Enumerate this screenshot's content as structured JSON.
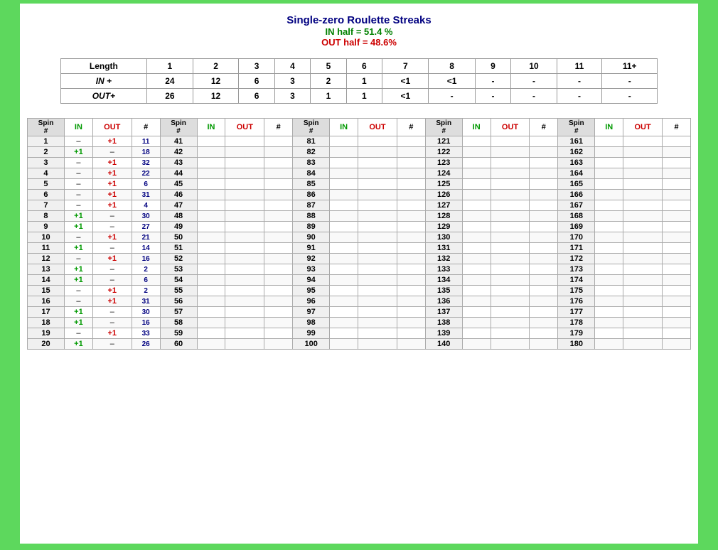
{
  "header": {
    "title": "Single-zero Roulette Streaks",
    "in_stat": "IN half = 51.4 %",
    "out_stat": "OUT half = 48.6%"
  },
  "summary": {
    "columns": [
      "Length",
      "1",
      "2",
      "3",
      "4",
      "5",
      "6",
      "7",
      "8",
      "9",
      "10",
      "11",
      "11+"
    ],
    "rows": [
      {
        "label": "IN +",
        "values": [
          "24",
          "12",
          "6",
          "3",
          "2",
          "1",
          "<1",
          "<1",
          "-",
          "-",
          "-",
          "-"
        ]
      },
      {
        "label": "OUT+",
        "values": [
          "26",
          "12",
          "6",
          "3",
          "1",
          "1",
          "<1",
          "-",
          "-",
          "-",
          "-",
          "-"
        ]
      }
    ]
  },
  "spin_columns": [
    {
      "spins": [
        {
          "num": 1,
          "in": "–",
          "out": "+1",
          "hash": "11"
        },
        {
          "num": 2,
          "in": "+1",
          "out": "–",
          "hash": "18"
        },
        {
          "num": 3,
          "in": "–",
          "out": "+1",
          "hash": "32"
        },
        {
          "num": 4,
          "in": "–",
          "out": "+1",
          "hash": "22"
        },
        {
          "num": 5,
          "in": "–",
          "out": "+1",
          "hash": "6"
        },
        {
          "num": 6,
          "in": "–",
          "out": "+1",
          "hash": "31"
        },
        {
          "num": 7,
          "in": "–",
          "out": "+1",
          "hash": "4"
        },
        {
          "num": 8,
          "in": "+1",
          "out": "–",
          "hash": "30"
        },
        {
          "num": 9,
          "in": "+1",
          "out": "–",
          "hash": "27"
        },
        {
          "num": 10,
          "in": "–",
          "out": "+1",
          "hash": "21"
        },
        {
          "num": 11,
          "in": "+1",
          "out": "–",
          "hash": "14"
        },
        {
          "num": 12,
          "in": "–",
          "out": "+1",
          "hash": "16"
        },
        {
          "num": 13,
          "in": "+1",
          "out": "–",
          "hash": "2"
        },
        {
          "num": 14,
          "in": "+1",
          "out": "–",
          "hash": "6"
        },
        {
          "num": 15,
          "in": "–",
          "out": "+1",
          "hash": "2"
        },
        {
          "num": 16,
          "in": "–",
          "out": "+1",
          "hash": "31"
        },
        {
          "num": 17,
          "in": "+1",
          "out": "–",
          "hash": "30"
        },
        {
          "num": 18,
          "in": "+1",
          "out": "–",
          "hash": "16"
        },
        {
          "num": 19,
          "in": "–",
          "out": "+1",
          "hash": "33"
        },
        {
          "num": 20,
          "in": "+1",
          "out": "–",
          "hash": "26"
        }
      ]
    },
    {
      "spins": [
        {
          "num": 41,
          "in": "",
          "out": "",
          "hash": ""
        },
        {
          "num": 42,
          "in": "",
          "out": "",
          "hash": ""
        },
        {
          "num": 43,
          "in": "",
          "out": "",
          "hash": ""
        },
        {
          "num": 44,
          "in": "",
          "out": "",
          "hash": ""
        },
        {
          "num": 45,
          "in": "",
          "out": "",
          "hash": ""
        },
        {
          "num": 46,
          "in": "",
          "out": "",
          "hash": ""
        },
        {
          "num": 47,
          "in": "",
          "out": "",
          "hash": ""
        },
        {
          "num": 48,
          "in": "",
          "out": "",
          "hash": ""
        },
        {
          "num": 49,
          "in": "",
          "out": "",
          "hash": ""
        },
        {
          "num": 50,
          "in": "",
          "out": "",
          "hash": ""
        },
        {
          "num": 51,
          "in": "",
          "out": "",
          "hash": ""
        },
        {
          "num": 52,
          "in": "",
          "out": "",
          "hash": ""
        },
        {
          "num": 53,
          "in": "",
          "out": "",
          "hash": ""
        },
        {
          "num": 54,
          "in": "",
          "out": "",
          "hash": ""
        },
        {
          "num": 55,
          "in": "",
          "out": "",
          "hash": ""
        },
        {
          "num": 56,
          "in": "",
          "out": "",
          "hash": ""
        },
        {
          "num": 57,
          "in": "",
          "out": "",
          "hash": ""
        },
        {
          "num": 58,
          "in": "",
          "out": "",
          "hash": ""
        },
        {
          "num": 59,
          "in": "",
          "out": "",
          "hash": ""
        },
        {
          "num": 60,
          "in": "",
          "out": "",
          "hash": ""
        }
      ]
    },
    {
      "spins": [
        {
          "num": 81,
          "in": "",
          "out": "",
          "hash": ""
        },
        {
          "num": 82,
          "in": "",
          "out": "",
          "hash": ""
        },
        {
          "num": 83,
          "in": "",
          "out": "",
          "hash": ""
        },
        {
          "num": 84,
          "in": "",
          "out": "",
          "hash": ""
        },
        {
          "num": 85,
          "in": "",
          "out": "",
          "hash": ""
        },
        {
          "num": 86,
          "in": "",
          "out": "",
          "hash": ""
        },
        {
          "num": 87,
          "in": "",
          "out": "",
          "hash": ""
        },
        {
          "num": 88,
          "in": "",
          "out": "",
          "hash": ""
        },
        {
          "num": 89,
          "in": "",
          "out": "",
          "hash": ""
        },
        {
          "num": 90,
          "in": "",
          "out": "",
          "hash": ""
        },
        {
          "num": 91,
          "in": "",
          "out": "",
          "hash": ""
        },
        {
          "num": 92,
          "in": "",
          "out": "",
          "hash": ""
        },
        {
          "num": 93,
          "in": "",
          "out": "",
          "hash": ""
        },
        {
          "num": 94,
          "in": "",
          "out": "",
          "hash": ""
        },
        {
          "num": 95,
          "in": "",
          "out": "",
          "hash": ""
        },
        {
          "num": 96,
          "in": "",
          "out": "",
          "hash": ""
        },
        {
          "num": 97,
          "in": "",
          "out": "",
          "hash": ""
        },
        {
          "num": 98,
          "in": "",
          "out": "",
          "hash": ""
        },
        {
          "num": 99,
          "in": "",
          "out": "",
          "hash": ""
        },
        {
          "num": 100,
          "in": "",
          "out": "",
          "hash": ""
        }
      ]
    },
    {
      "spins": [
        {
          "num": 121,
          "in": "",
          "out": "",
          "hash": ""
        },
        {
          "num": 122,
          "in": "",
          "out": "",
          "hash": ""
        },
        {
          "num": 123,
          "in": "",
          "out": "",
          "hash": ""
        },
        {
          "num": 124,
          "in": "",
          "out": "",
          "hash": ""
        },
        {
          "num": 125,
          "in": "",
          "out": "",
          "hash": ""
        },
        {
          "num": 126,
          "in": "",
          "out": "",
          "hash": ""
        },
        {
          "num": 127,
          "in": "",
          "out": "",
          "hash": ""
        },
        {
          "num": 128,
          "in": "",
          "out": "",
          "hash": ""
        },
        {
          "num": 129,
          "in": "",
          "out": "",
          "hash": ""
        },
        {
          "num": 130,
          "in": "",
          "out": "",
          "hash": ""
        },
        {
          "num": 131,
          "in": "",
          "out": "",
          "hash": ""
        },
        {
          "num": 132,
          "in": "",
          "out": "",
          "hash": ""
        },
        {
          "num": 133,
          "in": "",
          "out": "",
          "hash": ""
        },
        {
          "num": 134,
          "in": "",
          "out": "",
          "hash": ""
        },
        {
          "num": 135,
          "in": "",
          "out": "",
          "hash": ""
        },
        {
          "num": 136,
          "in": "",
          "out": "",
          "hash": ""
        },
        {
          "num": 137,
          "in": "",
          "out": "",
          "hash": ""
        },
        {
          "num": 138,
          "in": "",
          "out": "",
          "hash": ""
        },
        {
          "num": 139,
          "in": "",
          "out": "",
          "hash": ""
        },
        {
          "num": 140,
          "in": "",
          "out": "",
          "hash": ""
        }
      ]
    },
    {
      "spins": [
        {
          "num": 161,
          "in": "",
          "out": "",
          "hash": ""
        },
        {
          "num": 162,
          "in": "",
          "out": "",
          "hash": ""
        },
        {
          "num": 163,
          "in": "",
          "out": "",
          "hash": ""
        },
        {
          "num": 164,
          "in": "",
          "out": "",
          "hash": ""
        },
        {
          "num": 165,
          "in": "",
          "out": "",
          "hash": ""
        },
        {
          "num": 166,
          "in": "",
          "out": "",
          "hash": ""
        },
        {
          "num": 167,
          "in": "",
          "out": "",
          "hash": ""
        },
        {
          "num": 168,
          "in": "",
          "out": "",
          "hash": ""
        },
        {
          "num": 169,
          "in": "",
          "out": "",
          "hash": ""
        },
        {
          "num": 170,
          "in": "",
          "out": "",
          "hash": ""
        },
        {
          "num": 171,
          "in": "",
          "out": "",
          "hash": ""
        },
        {
          "num": 172,
          "in": "",
          "out": "",
          "hash": ""
        },
        {
          "num": 173,
          "in": "",
          "out": "",
          "hash": ""
        },
        {
          "num": 174,
          "in": "",
          "out": "",
          "hash": ""
        },
        {
          "num": 175,
          "in": "",
          "out": "",
          "hash": ""
        },
        {
          "num": 176,
          "in": "",
          "out": "",
          "hash": ""
        },
        {
          "num": 177,
          "in": "",
          "out": "",
          "hash": ""
        },
        {
          "num": 178,
          "in": "",
          "out": "",
          "hash": ""
        },
        {
          "num": 179,
          "in": "",
          "out": "",
          "hash": ""
        },
        {
          "num": 180,
          "in": "",
          "out": "",
          "hash": ""
        }
      ]
    }
  ],
  "labels": {
    "spin": "Spin #",
    "in": "IN",
    "out": "OUT",
    "hash": "#"
  }
}
